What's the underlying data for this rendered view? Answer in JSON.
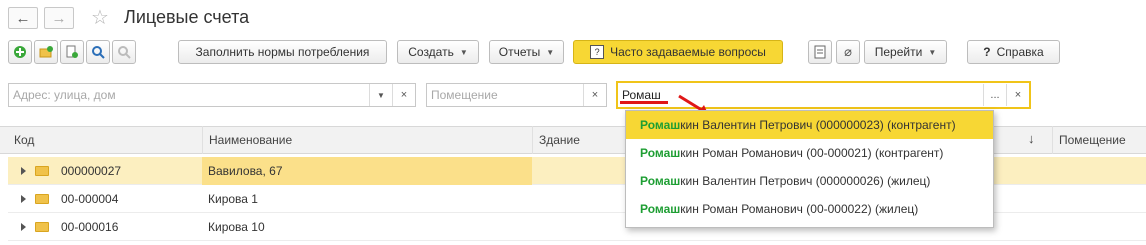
{
  "window": {
    "title": "Лицевые счета"
  },
  "toolbar": {
    "fill_norms": "Заполнить нормы потребления",
    "create": "Создать",
    "reports": "Отчеты",
    "faq": "Часто задаваемые вопросы",
    "go": "Перейти",
    "help": "Справка",
    "help_icon": "?"
  },
  "filters": {
    "address_placeholder": "Адрес: улица, дом",
    "room_placeholder": "Помещение",
    "search_value": "Ромаш",
    "more": "...",
    "clear": "×"
  },
  "table": {
    "columns": {
      "code": "Код",
      "name": "Наименование",
      "building": "Здание",
      "sort_arrow": "↓",
      "room": "Помещение"
    },
    "rows": [
      {
        "code": "000000027",
        "name": "Вавилова, 67"
      },
      {
        "code": "00-000004",
        "name": "Кирова 1"
      },
      {
        "code": "00-000016",
        "name": "Кирова 10"
      }
    ]
  },
  "suggestions": [
    {
      "match": "Ромаш",
      "rest": "кин Валентин Петрович (000000023) (контрагент)"
    },
    {
      "match": "Ромаш",
      "rest": "кин Роман Романович (00-000021) (контрагент)"
    },
    {
      "match": "Ромаш",
      "rest": "кин Валентин Петрович (000000026) (жилец)"
    },
    {
      "match": "Ромаш",
      "rest": "кин Роман Романович (00-000022) (жилец)"
    }
  ],
  "colors": {
    "accent_yellow": "#f7d734",
    "match_green": "#1e9e33",
    "annotation_red": "#e01818"
  }
}
